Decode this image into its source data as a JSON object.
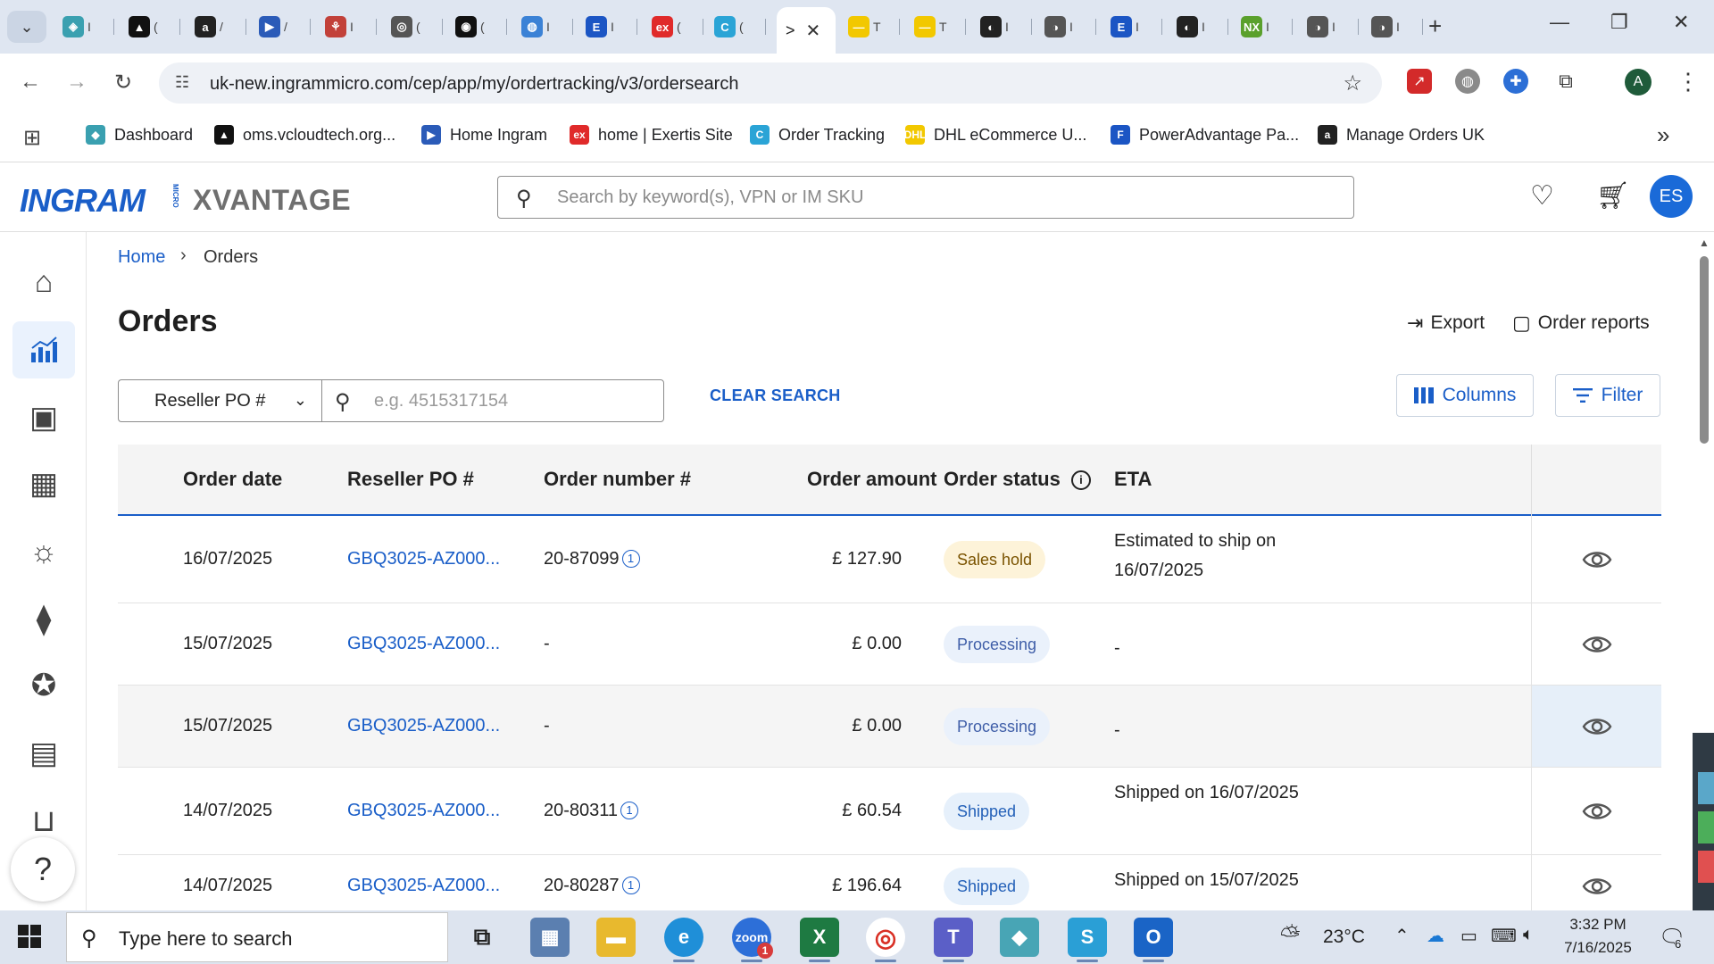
{
  "browser": {
    "active_tab_close": "✕",
    "tabs": [
      {
        "glyph": "◈",
        "color": "#3aa0b0",
        "label": "I"
      },
      {
        "glyph": "▲",
        "color": "#111111",
        "label": "("
      },
      {
        "glyph": "a",
        "color": "#222222",
        "label": "/"
      },
      {
        "glyph": "▶",
        "color": "#2b5bb8",
        "label": "/"
      },
      {
        "glyph": "⚘",
        "color": "#c2413a",
        "label": "I"
      },
      {
        "glyph": "◎",
        "color": "#555555",
        "label": "("
      },
      {
        "glyph": "◉",
        "color": "#111111",
        "label": "("
      },
      {
        "glyph": "◍",
        "color": "#3b82d6",
        "label": "I"
      },
      {
        "glyph": "E",
        "color": "#1b55c4",
        "label": "I"
      },
      {
        "glyph": "ex",
        "color": "#e02a2a",
        "label": "("
      },
      {
        "glyph": "C",
        "color": "#2aa4d6",
        "label": "("
      },
      {
        "glyph": "—",
        "color": "#f2c800",
        "label": "T"
      },
      {
        "glyph": "—",
        "color": "#f2c800",
        "label": "T"
      },
      {
        "glyph": "◐",
        "color": "#222222",
        "label": "I"
      },
      {
        "glyph": "◑",
        "color": "#555555",
        "label": "I"
      },
      {
        "glyph": "E",
        "color": "#1b55c4",
        "label": "I"
      },
      {
        "glyph": "◐",
        "color": "#222222",
        "label": "I"
      },
      {
        "glyph": "NX",
        "color": "#5aa02c",
        "label": "I"
      },
      {
        "glyph": "◑",
        "color": "#555555",
        "label": "I"
      },
      {
        "glyph": "◑",
        "color": "#555555",
        "label": "I"
      }
    ],
    "active_tab_label": ">",
    "new_tab": "+",
    "url": "uk-new.ingrammicro.com/cep/app/my/ordertracking/v3/ordersearch",
    "profile_initial": "A",
    "bookmarks": [
      {
        "label": "Dashboard",
        "glyph": "◆",
        "color": "#3aa0b0"
      },
      {
        "label": "oms.vcloudtech.org...",
        "glyph": "▲",
        "color": "#111111"
      },
      {
        "label": "Home Ingram",
        "glyph": "▶",
        "color": "#2b5bb8"
      },
      {
        "label": "home | Exertis Site",
        "glyph": "ex",
        "color": "#e02a2a"
      },
      {
        "label": "Order Tracking",
        "glyph": "C",
        "color": "#2aa4d6"
      },
      {
        "label": "DHL eCommerce U...",
        "glyph": "DHL",
        "color": "#f2c800"
      },
      {
        "label": "PowerAdvantage Pa...",
        "glyph": "F",
        "color": "#1b55c4"
      },
      {
        "label": "Manage Orders UK",
        "glyph": "a",
        "color": "#222222"
      }
    ]
  },
  "header": {
    "logo_brand": "INGRAM",
    "logo_micro": "MICRO",
    "logo_product": "XVANTAGE",
    "search_placeholder": "Search by keyword(s), VPN or IM SKU",
    "user_initials": "ES"
  },
  "breadcrumb": {
    "home": "Home",
    "separator": "›",
    "current": "Orders"
  },
  "page": {
    "title": "Orders",
    "export_label": "Export",
    "reports_label": "Order reports",
    "search_field_selected": "Reseller PO #",
    "search_placeholder": "e.g. 4515317154",
    "clear_search": "CLEAR SEARCH",
    "columns_label": "Columns",
    "filter_label": "Filter"
  },
  "table": {
    "headers": {
      "order_date": "Order date",
      "reseller_po": "Reseller PO #",
      "order_number": "Order number #",
      "order_amount": "Order amount",
      "order_status": "Order status",
      "eta": "ETA"
    },
    "rows": [
      {
        "date": "16/07/2025",
        "po": "GBQ3025-AZ000...",
        "order_number": "20-87099",
        "amount": "£ 127.90",
        "status": "Sales hold",
        "eta": "Estimated to ship on 16/07/2025"
      },
      {
        "date": "15/07/2025",
        "po": "GBQ3025-AZ000...",
        "order_number": "-",
        "amount": "£ 0.00",
        "status": "Processing",
        "eta": "-"
      },
      {
        "date": "15/07/2025",
        "po": "GBQ3025-AZ000...",
        "order_number": "-",
        "amount": "£ 0.00",
        "status": "Processing",
        "eta": "-"
      },
      {
        "date": "14/07/2025",
        "po": "GBQ3025-AZ000...",
        "order_number": "20-80311",
        "amount": "£ 60.54",
        "status": "Shipped",
        "eta": "Shipped on 16/07/2025"
      },
      {
        "date": "14/07/2025",
        "po": "GBQ3025-AZ000...",
        "order_number": "20-80287",
        "amount": "£ 196.64",
        "status": "Shipped",
        "eta": "Shipped on 15/07/2025"
      }
    ]
  },
  "taskbar": {
    "search_text": "Type here to search",
    "temperature": "23°C",
    "time": "3:32 PM",
    "date": "7/16/2025",
    "notification_count": "6",
    "teams_badge": "1"
  },
  "colors": {
    "accent": "#1a5ec8",
    "sales_hold_bg": "#fdf3d9",
    "processing_bg": "#eaf1fb",
    "shipped_bg": "#e6f0fb"
  }
}
